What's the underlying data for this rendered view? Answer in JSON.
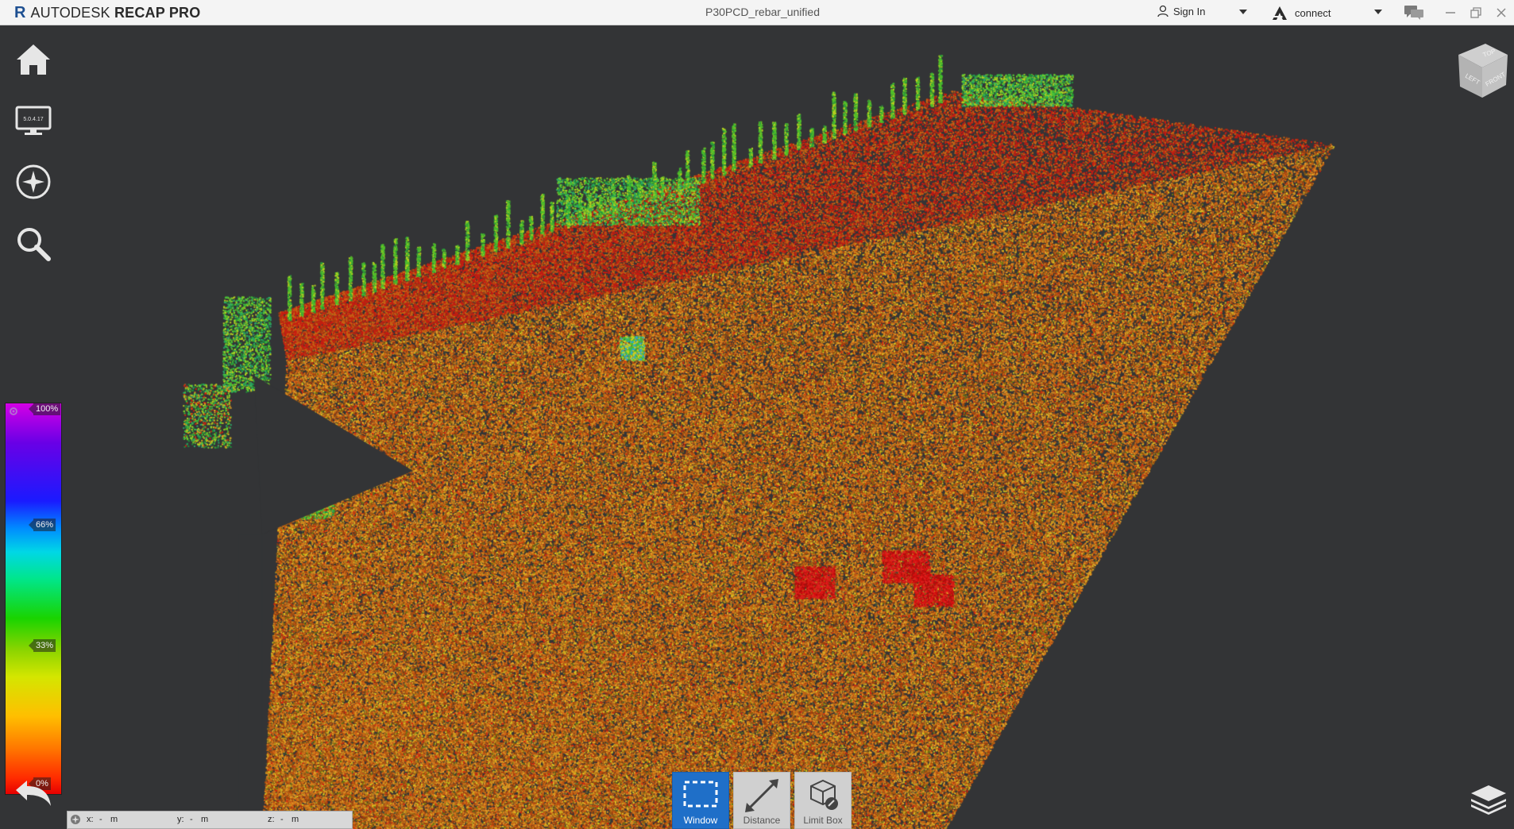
{
  "app": {
    "brand_letter": "R",
    "brand_name_light": "AUTODESK",
    "brand_name_bold": "RECAP PRO",
    "document_title": "P30PCD_rebar_unified"
  },
  "header": {
    "sign_in_label": "Sign In",
    "connect_label": "connect"
  },
  "left_toolbar": {
    "items": [
      {
        "name": "home",
        "icon": "home-icon"
      },
      {
        "name": "display",
        "icon": "monitor-icon",
        "version_text": "5.0.4.17"
      },
      {
        "name": "navigate",
        "icon": "compass-icon"
      },
      {
        "name": "zoom",
        "icon": "search-icon"
      }
    ]
  },
  "color_scale": {
    "ticks": [
      "100%",
      "66%",
      "33%",
      "0%"
    ]
  },
  "coordinates": {
    "x_label": "x:",
    "x_value": "-",
    "x_unit": "m",
    "y_label": "y:",
    "y_value": "-",
    "y_unit": "m",
    "z_label": "z:",
    "z_value": "-",
    "z_unit": "m"
  },
  "bottom_tools": [
    {
      "label": "Window",
      "icon": "window-select-icon",
      "active": true
    },
    {
      "label": "Distance",
      "icon": "distance-icon",
      "active": false
    },
    {
      "label": "Limit Box",
      "icon": "limit-box-icon",
      "active": false
    }
  ],
  "viewcube": {
    "top_label": "TOP",
    "left_label": "LEFT",
    "front_label": "FRONT"
  },
  "colors": {
    "accent": "#1f6fc8",
    "viewport_bg": "#333436",
    "titlebar_bg": "#f4f4f4"
  }
}
